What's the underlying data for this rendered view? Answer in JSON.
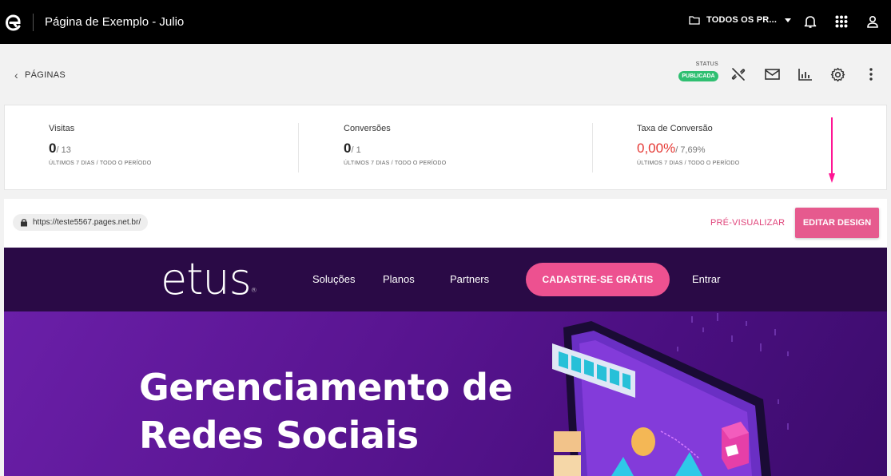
{
  "topbar": {
    "page_title": "Página de Exemplo - Julio",
    "project_selector": "TODOS OS PR...",
    "icons": [
      "logo-icon",
      "folder-icon",
      "bell-icon",
      "apps-grid-icon",
      "user-icon"
    ]
  },
  "subheader": {
    "back_label": "PÁGINAS",
    "status_label": "STATUS",
    "status_value": "PUBLICADA",
    "status_color": "#2fbf71",
    "icons": [
      "unlink-icon",
      "mail-icon",
      "bar-chart-icon",
      "settings-icon",
      "more-vertical-icon"
    ]
  },
  "stats": [
    {
      "label": "Visitas",
      "value": "0",
      "total": "/ 13",
      "period": "ÚLTIMOS 7 DIAS / TODO O PERÍODO"
    },
    {
      "label": "Conversões",
      "value": "0",
      "total": "/ 1",
      "period": "ÚLTIMOS 7 DIAS / TODO O PERÍODO"
    },
    {
      "label": "Taxa de Conversão",
      "value": "0,00%",
      "total": "/ 7,69%",
      "period": "ÚLTIMOS 7 DIAS / TODO O PERÍODO"
    }
  ],
  "urlbar": {
    "url": "https://teste5567.pages.net.br/",
    "preview_label": "PRÉ-VISUALIZAR",
    "edit_label": "EDITAR DESIGN",
    "accent_color": "#e65a8e"
  },
  "site": {
    "brand": "etus",
    "brand_mark": "®",
    "nav": [
      "Soluções",
      "Planos",
      "Partners"
    ],
    "cta": "CADASTRE-SE GRÁTIS",
    "login": "Entrar",
    "headline_line1": "Gerenciamento de",
    "headline_line2": "Redes Sociais"
  }
}
